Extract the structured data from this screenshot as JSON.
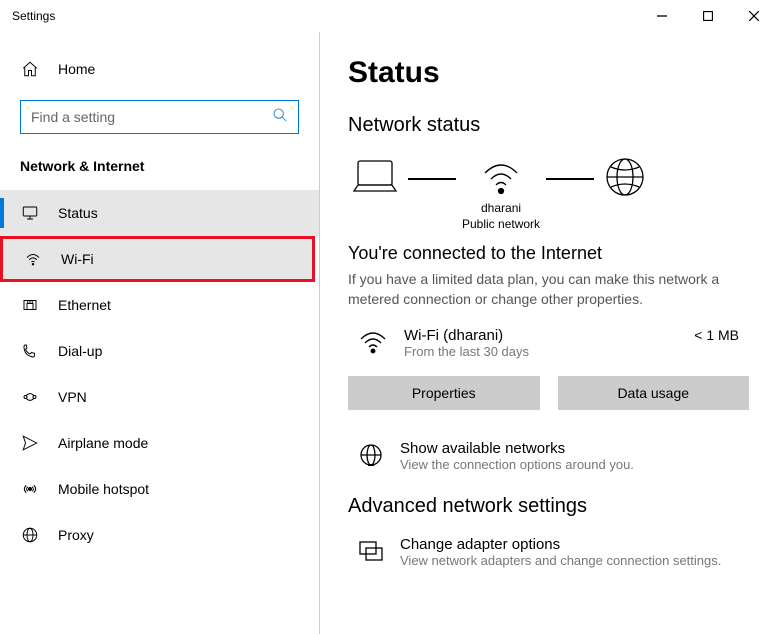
{
  "window": {
    "title": "Settings"
  },
  "sidebar": {
    "home": "Home",
    "search_placeholder": "Find a setting",
    "category": "Network & Internet",
    "items": [
      {
        "label": "Status"
      },
      {
        "label": "Wi-Fi"
      },
      {
        "label": "Ethernet"
      },
      {
        "label": "Dial-up"
      },
      {
        "label": "VPN"
      },
      {
        "label": "Airplane mode"
      },
      {
        "label": "Mobile hotspot"
      },
      {
        "label": "Proxy"
      }
    ]
  },
  "main": {
    "title": "Status",
    "network_status": "Network status",
    "diagram": {
      "ssid": "dharani",
      "type": "Public network"
    },
    "connected_title": "You're connected to the Internet",
    "connected_desc": "If you have a limited data plan, you can make this network a metered connection or change other properties.",
    "wifi": {
      "name": "Wi-Fi (dharani)",
      "sub": "From the last 30 days",
      "data": "< 1 MB"
    },
    "buttons": {
      "properties": "Properties",
      "data_usage": "Data usage"
    },
    "show_networks": {
      "name": "Show available networks",
      "sub": "View the connection options around you."
    },
    "advanced": "Advanced network settings",
    "adapter": {
      "name": "Change adapter options",
      "sub": "View network adapters and change connection settings."
    }
  }
}
